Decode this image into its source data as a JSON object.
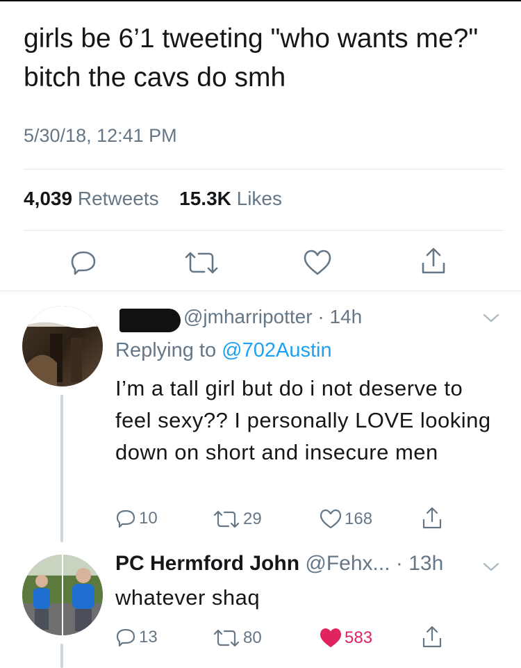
{
  "main_tweet": {
    "text": "girls be 6’1 tweeting \"who wants me?\" bitch the cavs do smh",
    "timestamp": "5/30/18, 12:41 PM",
    "retweets_count": "4,039",
    "retweets_label": "Retweets",
    "likes_count": "15.3K",
    "likes_label": "Likes"
  },
  "replies": [
    {
      "handle": "@jmharripotter",
      "time": "14h",
      "replying_to_label": "Replying to",
      "replying_to_handle": "@702Austin",
      "text": "I’m a tall girl but do i not deserve to feel sexy?? I personally LOVE looking down on short and insecure men",
      "reply_count": "10",
      "retweet_count": "29",
      "like_count": "168"
    },
    {
      "name": "PC Hermford John",
      "handle": "@Fehx...",
      "time": "13h",
      "text": "whatever shaq",
      "reply_count": "13",
      "retweet_count": "80",
      "like_count": "583",
      "liked": true
    }
  ],
  "colors": {
    "text": "#14171a",
    "secondary": "#657786",
    "link": "#1da1f2",
    "like": "#e0245e",
    "divider": "#e1e8ed"
  },
  "icons": [
    "reply-icon",
    "retweet-icon",
    "heart-icon",
    "share-icon",
    "chevron-down-icon"
  ]
}
